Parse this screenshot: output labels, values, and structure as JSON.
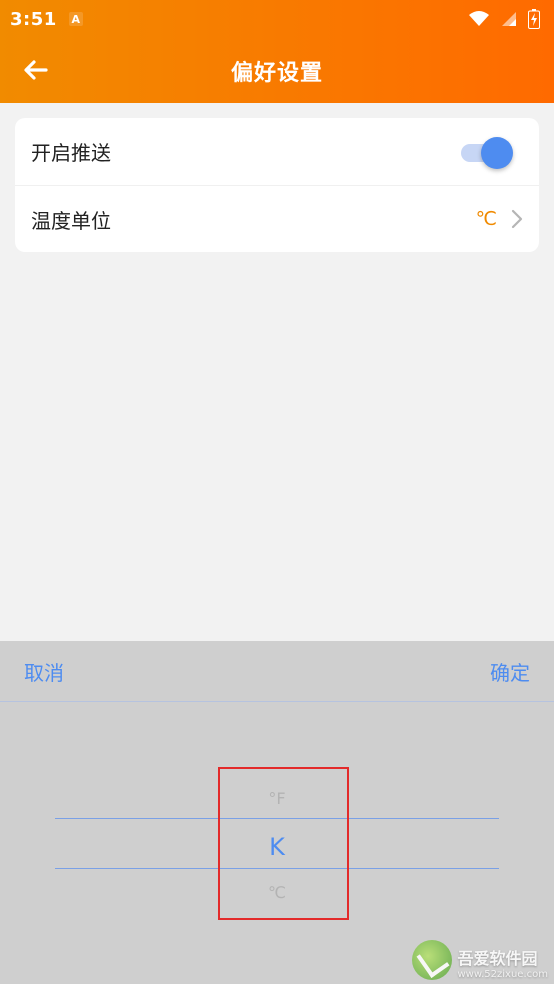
{
  "status_bar": {
    "time": "3:51",
    "notification_badge": "A",
    "icons": [
      "wifi-icon",
      "cell-signal-icon",
      "battery-charging-icon"
    ]
  },
  "app_bar": {
    "title": "偏好设置",
    "back_icon": "arrow-left-icon"
  },
  "settings": {
    "push": {
      "label": "开启推送",
      "enabled": true
    },
    "temperature_unit": {
      "label": "温度单位",
      "value": "℃"
    }
  },
  "picker": {
    "cancel_label": "取消",
    "confirm_label": "确定",
    "options": [
      "°F",
      "K",
      "℃"
    ],
    "selected": "K"
  },
  "watermark": {
    "cn": "吾爱软件园",
    "en": "www.52zixue.com"
  },
  "colors": {
    "header_start": "#f18b00",
    "header_end": "#ff6a00",
    "accent": "#4e8cf0",
    "temp_value": "#f08a00",
    "overlay": "#cfcfcf",
    "highlight": "#e32a2a"
  }
}
